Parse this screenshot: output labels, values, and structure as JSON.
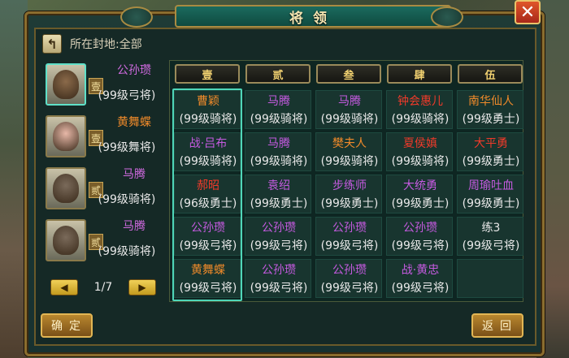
{
  "window": {
    "title": "将领",
    "close_label": "✕"
  },
  "fief": {
    "label": "所在封地:全部"
  },
  "generals": [
    {
      "rank": "壹",
      "name": "公孙瓒",
      "level": "(99级弓将)",
      "name_color": "purple",
      "face_color": "#8b6a4a"
    },
    {
      "rank": "壹",
      "name": "黄舞蝶",
      "level": "(99级舞将)",
      "name_color": "orange",
      "face_color": "#e8b8a8"
    },
    {
      "rank": "贰",
      "name": "马腾",
      "level": "(99级骑将)",
      "name_color": "purple",
      "face_color": "#7a6a5a"
    },
    {
      "rank": "贰",
      "name": "马腾",
      "level": "(99级骑将)",
      "name_color": "purple",
      "face_color": "#7a6a5a"
    }
  ],
  "pager": {
    "text": "1/7",
    "prev": "◀",
    "next": "▶"
  },
  "columns": [
    "壹",
    "贰",
    "叁",
    "肆",
    "伍"
  ],
  "grid": [
    [
      {
        "name": "曹颖",
        "level": "(99级骑将)",
        "color": "orange"
      },
      {
        "name": "战·吕布",
        "level": "(99级骑将)",
        "color": "purple"
      },
      {
        "name": "郝昭",
        "level": "(96级勇士)",
        "color": "red"
      },
      {
        "name": "公孙瓒",
        "level": "(99级弓将)",
        "color": "purple"
      },
      {
        "name": "黄舞蝶",
        "level": "(99级弓将)",
        "color": "orange"
      }
    ],
    [
      {
        "name": "马腾",
        "level": "(99级骑将)",
        "color": "purple"
      },
      {
        "name": "马腾",
        "level": "(99级骑将)",
        "color": "purple"
      },
      {
        "name": "袁绍",
        "level": "(99级勇士)",
        "color": "purple"
      },
      {
        "name": "公孙瓒",
        "level": "(99级弓将)",
        "color": "purple"
      },
      {
        "name": "公孙瓒",
        "level": "(99级弓将)",
        "color": "purple"
      }
    ],
    [
      {
        "name": "马腾",
        "level": "(99级骑将)",
        "color": "purple"
      },
      {
        "name": "樊夫人",
        "level": "(99级骑将)",
        "color": "orange"
      },
      {
        "name": "步练师",
        "level": "(99级勇士)",
        "color": "purple"
      },
      {
        "name": "公孙瓒",
        "level": "(99级弓将)",
        "color": "purple"
      },
      {
        "name": "公孙瓒",
        "level": "(99级弓将)",
        "color": "purple"
      }
    ],
    [
      {
        "name": "钟会惠儿",
        "level": "(99级骑将)",
        "color": "red"
      },
      {
        "name": "夏侯嫃",
        "level": "(99级骑将)",
        "color": "red"
      },
      {
        "name": "大统勇",
        "level": "(99级勇士)",
        "color": "purple"
      },
      {
        "name": "公孙瓒",
        "level": "(99级弓将)",
        "color": "purple"
      },
      {
        "name": "战·黄忠",
        "level": "(99级弓将)",
        "color": "purple"
      }
    ],
    [
      {
        "name": "南华仙人",
        "level": "(99级勇士)",
        "color": "orange"
      },
      {
        "name": "大平勇",
        "level": "(99级勇士)",
        "color": "red"
      },
      {
        "name": "周瑜吐血",
        "level": "(99级勇士)",
        "color": "purple"
      },
      {
        "name": "练3",
        "level": "(99级弓将)",
        "color": "white"
      },
      {
        "name": "",
        "level": "",
        "color": "white"
      }
    ]
  ],
  "buttons": {
    "confirm": "确定",
    "back": "返回"
  },
  "colors": {
    "highlight": "#4fd6b8",
    "gold_border": "#a98b42",
    "panel_bg": "#173130"
  }
}
